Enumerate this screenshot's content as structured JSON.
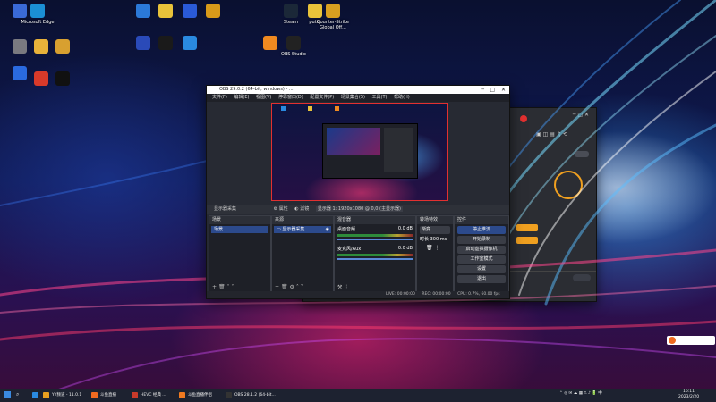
{
  "desktop": {
    "icons": [
      {
        "label": "",
        "color": "#3a6ad8"
      },
      {
        "label": "Microsoft Edge",
        "color": "#1b8fd4"
      },
      {
        "label": "",
        "color": "#7a7a80"
      },
      {
        "label": "",
        "color": "#e8b23a"
      },
      {
        "label": "",
        "color": "#d8a030"
      },
      {
        "label": "",
        "color": "#2a6ae0"
      },
      {
        "label": "",
        "color": "#d83a2a"
      },
      {
        "label": "",
        "color": "#111111"
      },
      {
        "label": "",
        "color": "#2b79d8"
      },
      {
        "label": "",
        "color": "#e8c23a"
      },
      {
        "label": "",
        "color": "#2a5ad8"
      },
      {
        "label": "",
        "color": "#d89a1a"
      },
      {
        "label": "",
        "color": "#2a4ab8"
      },
      {
        "label": "",
        "color": "#1a1a1a"
      },
      {
        "label": "",
        "color": "#2a8ae0"
      },
      {
        "label": "Steam",
        "color": "#1b2838"
      },
      {
        "label": "putty",
        "color": "#e8c23a"
      },
      {
        "label": "Counter-Strike Global Off...",
        "color": "#d8a020"
      },
      {
        "label": "",
        "color": "#f08a20"
      },
      {
        "label": "OBS Studio",
        "color": "#222222"
      }
    ]
  },
  "obs": {
    "title": "OBS 29.0.2 (64-bit, windows) - ...",
    "menu": [
      "文件(F)",
      "编辑(E)",
      "视图(V)",
      "停靠窗口(D)",
      "配置文件(P)",
      "场景集合(S)",
      "工具(T)",
      "帮助(H)"
    ],
    "scene_bar": {
      "current": "显示器采集",
      "properties": "属性",
      "filters": "滤镜",
      "display": "显示器 1: 1920x1080 @ 0,0 (主显示器)"
    },
    "panels": {
      "scenes": {
        "title": "场景",
        "items": [
          "场景"
        ]
      },
      "sources": {
        "title": "来源",
        "items": [
          "显示器采集"
        ]
      },
      "mixer": {
        "title": "混音器",
        "tracks": [
          {
            "name": "桌面音频",
            "db": "0.0 dB"
          },
          {
            "name": "麦克风/Aux",
            "db": "0.0 dB"
          }
        ]
      },
      "transitions": {
        "title": "转场特效",
        "type": "渐变",
        "duration_label": "时长",
        "duration": "300 ms"
      },
      "controls": {
        "title": "控件",
        "buttons": [
          "停止推流",
          "开始录制",
          "启动虚拟摄像机",
          "工作室模式",
          "设置",
          "退出"
        ]
      }
    },
    "status": {
      "live": "LIVE: 00:00:00",
      "rec": "REC: 00:00:00",
      "cpu": "CPU: 0.7%, 60.00 fps"
    }
  },
  "taskbar": {
    "items": [
      {
        "label": "",
        "color": "#2a8ae0"
      },
      {
        "label": "YY频道 - 11.0.1",
        "color": "#e8a020"
      },
      {
        "label": "斗鱼直播",
        "color": "#f06a20"
      },
      {
        "label": "HEVC 经典 ...",
        "color": "#c83a2a"
      },
      {
        "label": "斗鱼直播伴侣",
        "color": "#f07a20"
      },
      {
        "label": "OBS 28.1.2 (64-bit...",
        "color": "#333333"
      }
    ],
    "time": "16:11",
    "date": "2023/2/20"
  },
  "colors": {
    "accent": "#2c4a8c",
    "record": "#e23030"
  }
}
